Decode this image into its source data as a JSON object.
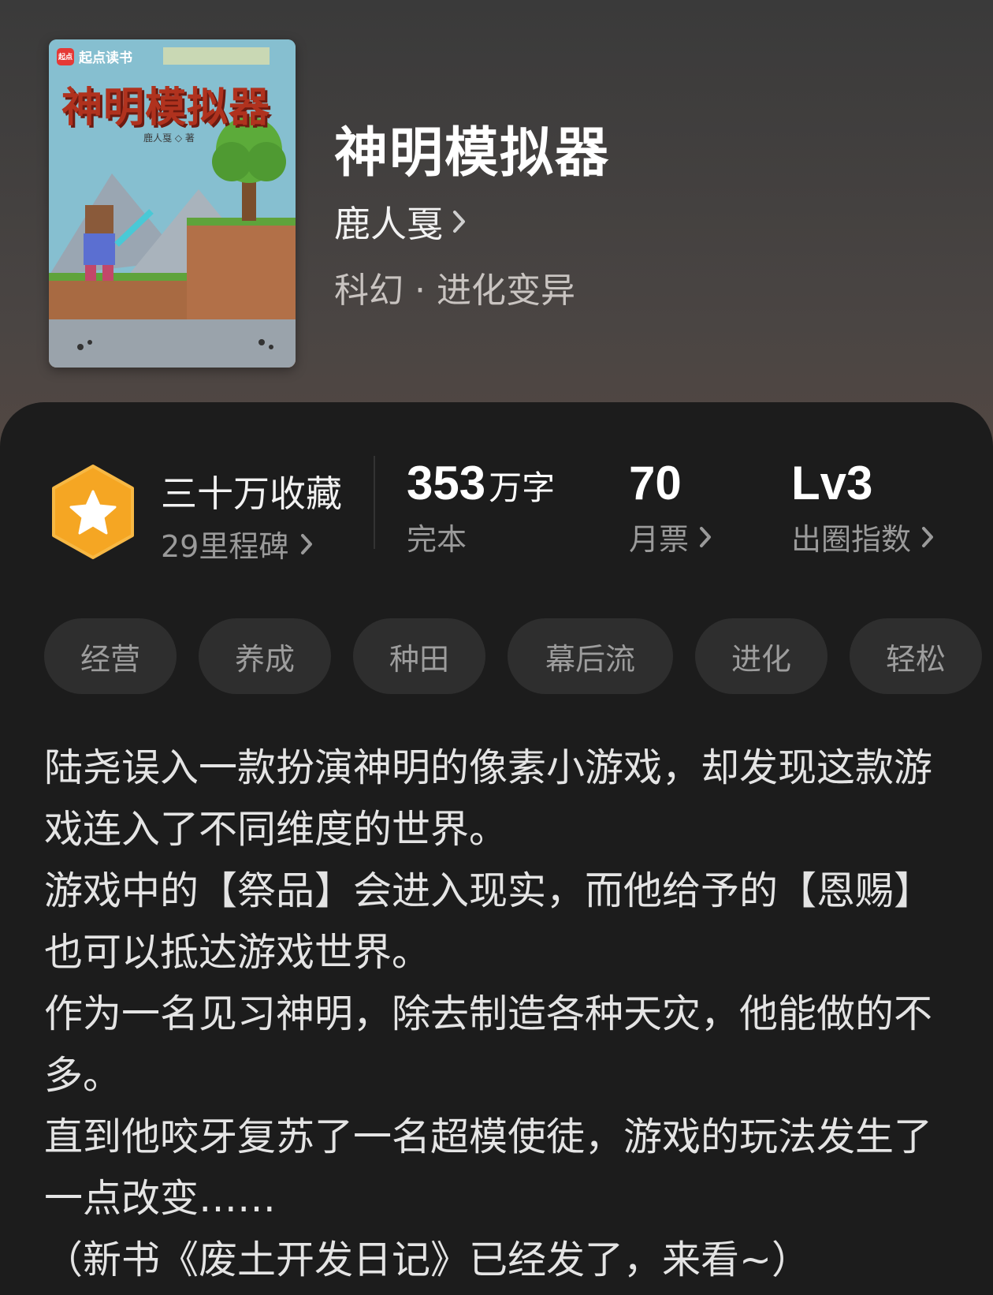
{
  "book": {
    "cover": {
      "brand": "起点读书",
      "logo_text": "起点",
      "title": "神明模拟器",
      "author": "鹿人戛 ◇ 著"
    },
    "title": "神明模拟器",
    "author": "鹿人戛",
    "genre": "科幻 · 进化变异"
  },
  "stats": {
    "collect_title": "三十万收藏",
    "milestones": "29里程碑",
    "words_num": "353",
    "words_unit": "万字",
    "status": "完本",
    "monthly_votes": "70",
    "monthly_votes_label": "月票",
    "level": "Lv3",
    "level_label": "出圈指数"
  },
  "tags": [
    "经营",
    "养成",
    "种田",
    "幕后流",
    "进化",
    "轻松"
  ],
  "description": [
    "陆尧误入一款扮演神明的像素小游戏，却发现这款游戏连入了不同维度的世界。",
    "游戏中的【祭品】会进入现实，而他给予的【恩赐】也可以抵达游戏世界。",
    "作为一名见习神明，除去制造各种天灾，他能做的不多。",
    "直到他咬牙复苏了一名超模使徒，游戏的玩法发生了一点改变……",
    "（新书《废土开发日记》已经发了，来看~）"
  ],
  "colors": {
    "panel": "#1c1c1c",
    "tag_bg": "#2e2e2e",
    "badge": "#f5a623"
  },
  "icons": [
    "star-badge-icon",
    "chevron-right-icon"
  ]
}
